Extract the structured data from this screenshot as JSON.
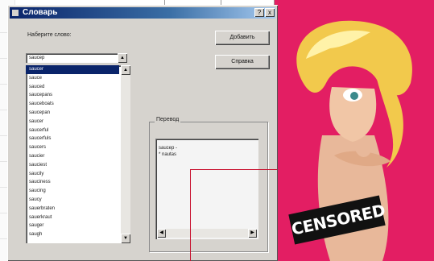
{
  "window": {
    "title": "Словарь",
    "controls": [
      "?",
      "x"
    ]
  },
  "left_panel": {
    "label": "Наберите слово:",
    "input_value": "saucep",
    "items": [
      "saucer",
      "sauce",
      "sauced",
      "saucepans",
      "sauceboats",
      "saucepan",
      "saucer",
      "saucerful",
      "saucerfuls",
      "saucers",
      "saucier",
      "sauciest",
      "saucily",
      "sauciness",
      "saucing",
      "saucy",
      "sauerbraten",
      "sauerkraut",
      "sauger",
      "saugh"
    ]
  },
  "buttons": {
    "add": "Добавить",
    "help": "Справка"
  },
  "translation": {
    "legend": "Перевод",
    "lines": [
      "saucep -",
      "* nautas"
    ]
  },
  "overlay": {
    "censor_text": "CENSORED"
  },
  "colors": {
    "accent_pink": "#e31e63",
    "title_bar": "#0a246a",
    "selection": "#0a246a"
  }
}
